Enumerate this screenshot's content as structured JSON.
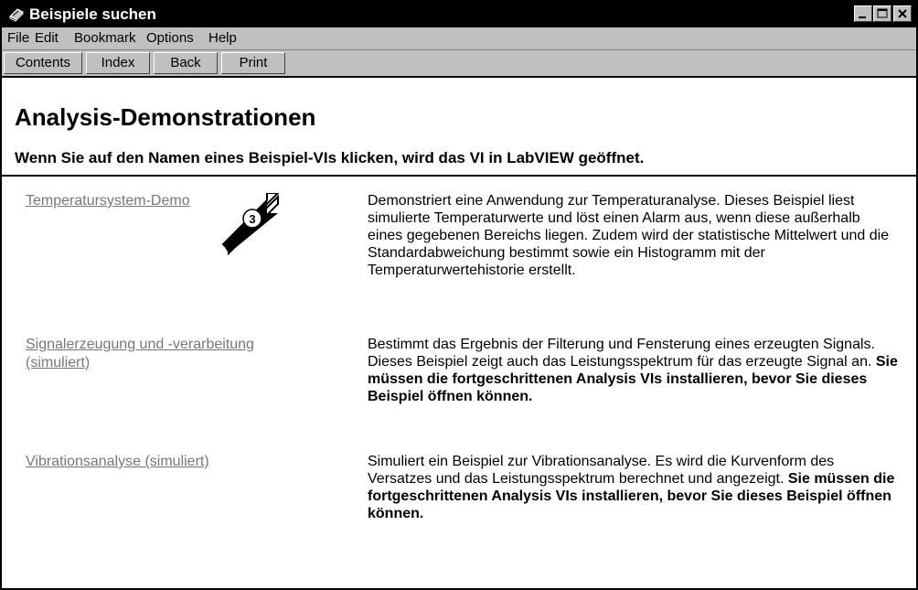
{
  "window": {
    "title": "Beispiele suchen"
  },
  "menu": {
    "items": [
      "File",
      "Edit",
      "Bookmark",
      "Options",
      "Help"
    ]
  },
  "toolbar": {
    "buttons": [
      "Contents",
      "Index",
      "Back",
      "Print"
    ]
  },
  "page": {
    "heading": "Analysis-Demonstrationen",
    "subheading": "Wenn Sie auf den Namen eines Beispiel-VIs klicken, wird das VI in LabVIEW geöffnet."
  },
  "examples": [
    {
      "link": "Temperatursystem-Demo",
      "description": "Demonstriert eine Anwendung zur Temperaturanalyse. Dieses Beispiel liest simulierte Temperaturwerte und löst einen Alarm aus, wenn diese außerhalb eines gegebenen Bereichs liegen. Zudem wird der statistische Mittelwert und die Standardabweichung bestimmt sowie ein Histogramm mit der Temperaturwertehistorie erstellt.",
      "note": ""
    },
    {
      "link": "Signalerzeugung und -verarbeitung (simuliert)",
      "description": "Bestimmt das Ergebnis der Filterung und Fensterung eines erzeugten Signals. Dieses Beispiel zeigt auch das Leistungsspektrum für das erzeugte Signal an.",
      "note": "Sie müssen die fortgeschrittenen Analysis VIs installieren, bevor Sie dieses Beispiel öffnen können."
    },
    {
      "link": "Vibrationsanalyse (simuliert)",
      "description": "Simuliert ein Beispiel zur Vibrationsanalyse. Es wird die Kurvenform des Versatzes und das Leistungsspektrum berechnet und angezeigt.",
      "note": "Sie müssen die fortgeschrittenen Analysis VIs installieren, bevor Sie dieses Beispiel öffnen können."
    }
  ],
  "callout": {
    "number": "3"
  }
}
